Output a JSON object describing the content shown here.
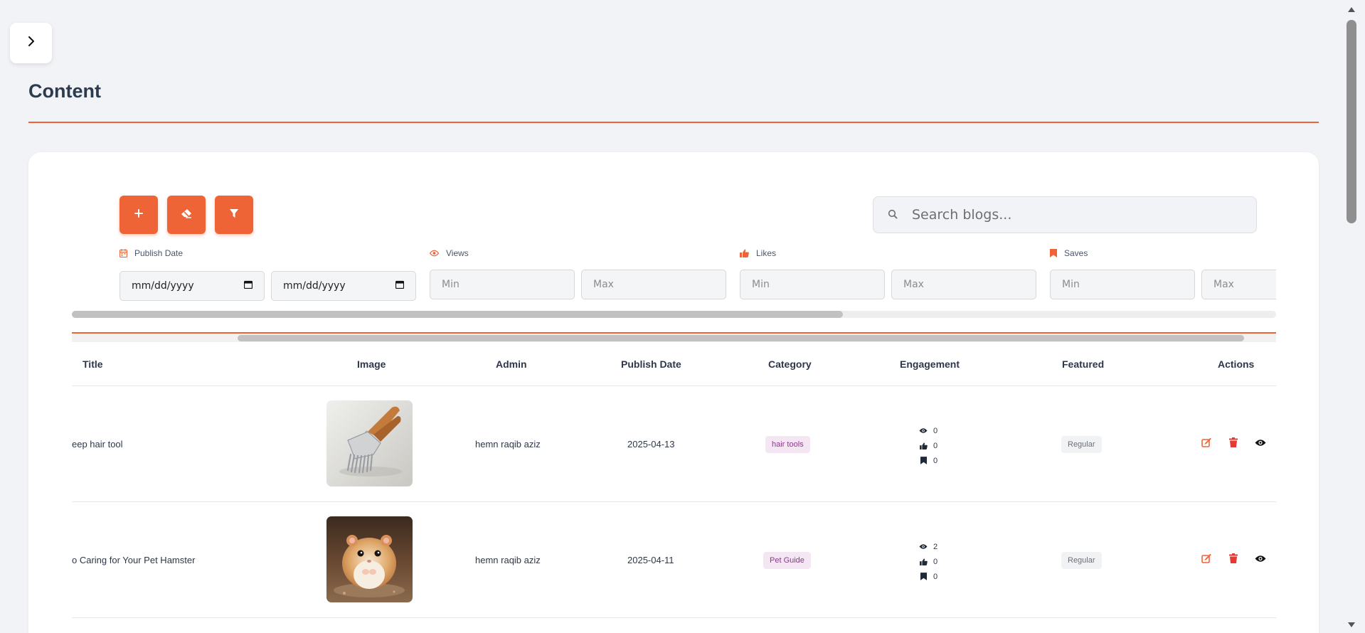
{
  "sidebar_toggle": {
    "icon": "chevron-right-icon"
  },
  "page": {
    "title": "Content"
  },
  "toolbar": {
    "add_icon": "plus-icon",
    "clear_icon": "eraser-icon",
    "filter_icon": "filter-icon",
    "search_placeholder": "Search blogs..."
  },
  "filters": {
    "publish_date": {
      "label": "Publish Date",
      "icon": "calendar-icon",
      "from": "mm/dd/yyyy",
      "to": "mm/dd/yyyy"
    },
    "views": {
      "label": "Views",
      "icon": "eye-icon",
      "min_placeholder": "Min",
      "max_placeholder": "Max"
    },
    "likes": {
      "label": "Likes",
      "icon": "thumbs-up-icon",
      "min_placeholder": "Min",
      "max_placeholder": "Max"
    },
    "saves": {
      "label": "Saves",
      "icon": "bookmark-icon",
      "min_placeholder": "Min",
      "max_placeholder": "Max"
    }
  },
  "table": {
    "columns": [
      "Title",
      "Image",
      "Admin",
      "Publish Date",
      "Category",
      "Engagement",
      "Featured",
      "Actions"
    ],
    "rows": [
      {
        "title": "eep hair tool",
        "image": "hair-tool-image",
        "admin": "hemn raqib aziz",
        "publish_date": "2025-04-13",
        "category": "hair tools",
        "views": "0",
        "likes": "0",
        "saves": "0",
        "featured": "Regular"
      },
      {
        "title": "o Caring for Your Pet Hamster",
        "image": "hamster-image",
        "admin": "hemn raqib aziz",
        "publish_date": "2025-04-11",
        "category": "Pet Guide",
        "views": "2",
        "likes": "0",
        "saves": "0",
        "featured": "Regular"
      }
    ]
  },
  "colors": {
    "accent": "#ee6436",
    "background": "#f2f3f7",
    "edit": "#ee6436",
    "delete": "#e53935"
  }
}
